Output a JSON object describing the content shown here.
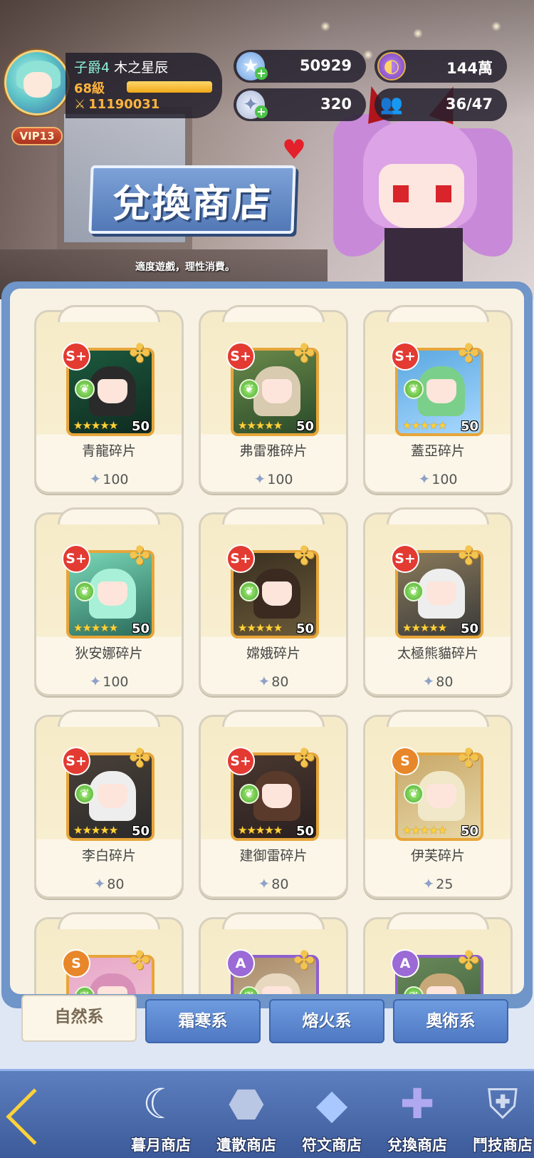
{
  "header": {
    "player_title": "子爵4",
    "player_name": "木之星辰",
    "level": "68級",
    "level_progress": 1.0,
    "power": "11190031",
    "vip": "VIP13",
    "resources": [
      {
        "icon": "star-icon",
        "value": "50929"
      },
      {
        "icon": "coin-icon",
        "value": "144萬"
      },
      {
        "icon": "puzzle-piece-icon",
        "value": "320"
      },
      {
        "icon": "people-icon",
        "value": "36/47"
      }
    ]
  },
  "shop": {
    "title": "兌換商店",
    "notice": "適度遊戲，理性消費。"
  },
  "items": [
    {
      "rank": "S+",
      "name": "青龍碎片",
      "level": "50",
      "price": "100"
    },
    {
      "rank": "S+",
      "name": "弗雷雅碎片",
      "level": "50",
      "price": "100"
    },
    {
      "rank": "S+",
      "name": "蓋亞碎片",
      "level": "50",
      "price": "100"
    },
    {
      "rank": "S+",
      "name": "狄安娜碎片",
      "level": "50",
      "price": "100"
    },
    {
      "rank": "S+",
      "name": "嫦娥碎片",
      "level": "50",
      "price": "80"
    },
    {
      "rank": "S+",
      "name": "太極熊貓碎片",
      "level": "50",
      "price": "80"
    },
    {
      "rank": "S+",
      "name": "李白碎片",
      "level": "50",
      "price": "80"
    },
    {
      "rank": "S+",
      "name": "建御雷碎片",
      "level": "50",
      "price": "80"
    },
    {
      "rank": "S",
      "name": "伊芙碎片",
      "level": "50",
      "price": "25"
    },
    {
      "rank": "S",
      "name": "",
      "level": "",
      "price": ""
    },
    {
      "rank": "A",
      "name": "",
      "level": "",
      "price": ""
    },
    {
      "rank": "A",
      "name": "",
      "level": "",
      "price": ""
    }
  ],
  "tabs": [
    {
      "label": "自然系",
      "active": true
    },
    {
      "label": "霜寒系",
      "active": false
    },
    {
      "label": "熔火系",
      "active": false
    },
    {
      "label": "奧術系",
      "active": false
    }
  ],
  "bottom_nav": [
    {
      "label": "暮月商店",
      "icon": "moon-icon"
    },
    {
      "label": "遺散商店",
      "icon": "stone-icon"
    },
    {
      "label": "符文商店",
      "icon": "crystal-icon"
    },
    {
      "label": "兌換商店",
      "icon": "puzzle-icon",
      "active": true
    },
    {
      "label": "鬥技商店",
      "icon": "shield-icon"
    }
  ],
  "colors": {
    "panel_border": "#6f95c9",
    "rank_splus": "#e33a32",
    "rank_s": "#e8862a",
    "rank_a": "#9b6ad6",
    "tab_active": "#fbf6e8"
  }
}
